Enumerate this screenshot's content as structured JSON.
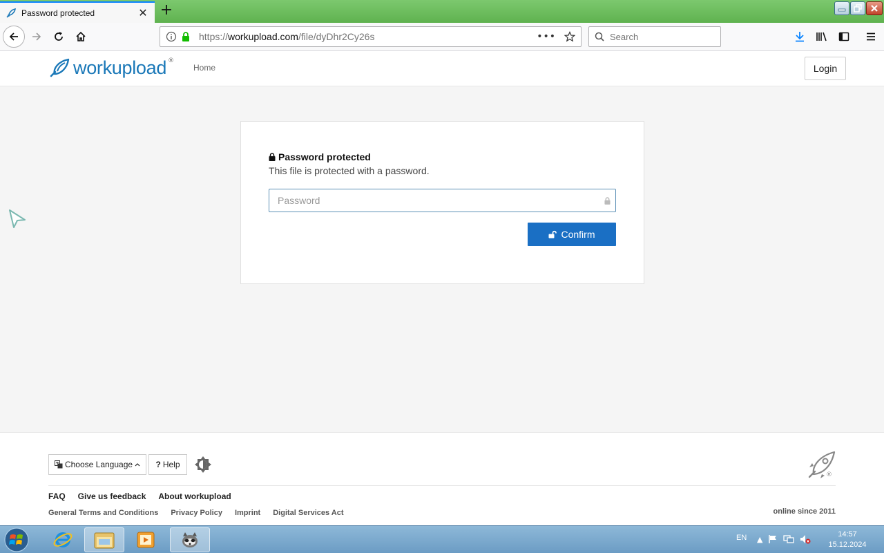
{
  "browser": {
    "tab_title": "Password protected",
    "url_prefix": "https://",
    "url_domain": "workupload.com",
    "url_path": "/file/dyDhr2Cy26s",
    "search_placeholder": "Search"
  },
  "site": {
    "logo_text": "workupload",
    "logo_reg": "®",
    "nav_home": "Home",
    "login_label": "Login"
  },
  "card": {
    "title": "Password protected",
    "subtitle": "This file is protected with a password.",
    "password_placeholder": "Password",
    "confirm_label": "Confirm"
  },
  "footer": {
    "language_label": "Choose Language",
    "help_label": "Help",
    "help_prefix": "?",
    "main_links": [
      "FAQ",
      "Give us feedback",
      "About workupload"
    ],
    "small_links": [
      "General Terms and Conditions",
      "Privacy Policy",
      "Imprint",
      "Digital Services Act"
    ],
    "online_since": "online since 2011",
    "rocket_reg": "®"
  },
  "taskbar": {
    "language": "EN",
    "time": "14:57",
    "date": "15.12.2024"
  },
  "colors": {
    "accent_blue": "#1a6fc4",
    "logo_blue": "#1a78b8",
    "tabbar_green": "#5fb24f"
  }
}
